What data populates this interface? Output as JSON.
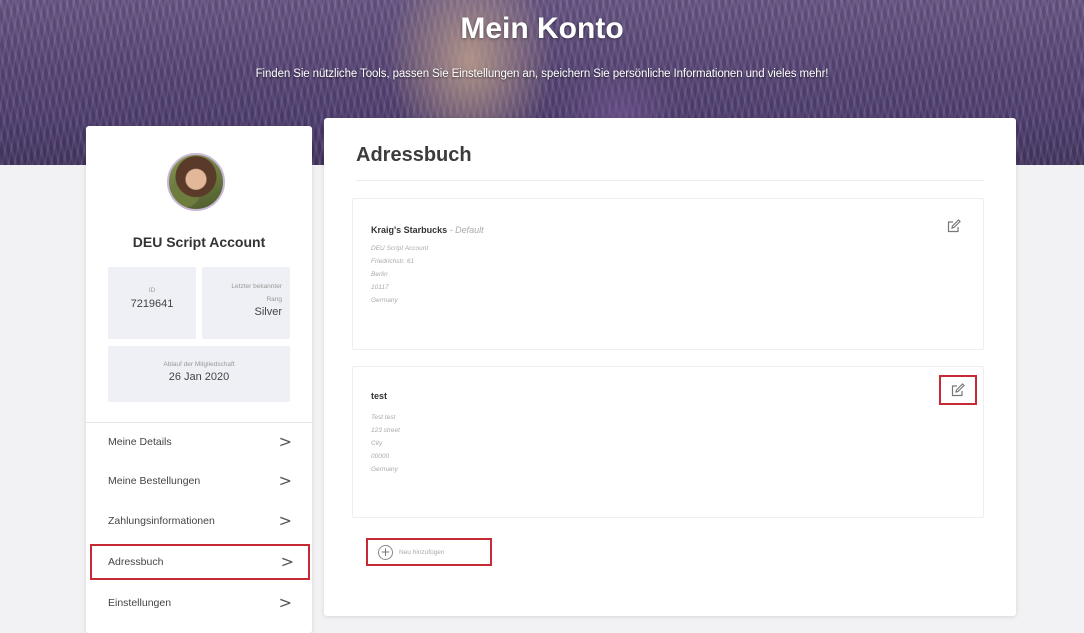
{
  "hero": {
    "title": "Mein Konto",
    "subtitle": "Finden Sie nützliche Tools, passen Sie Einstellungen an, speichern Sie persönliche Informationen und vieles mehr!"
  },
  "profile": {
    "name": "DEU Script Account",
    "id_label": "ID",
    "id_value": "7219641",
    "tier_label_1": "Letzter bekannter",
    "tier_label_2": "Rang",
    "tier_value": "Silver",
    "member_label": "Ablauf der Mitgliedschaft",
    "member_value": "26 Jan 2020"
  },
  "nav": {
    "items": [
      {
        "label": "Meine Details",
        "chevron": ">"
      },
      {
        "label": "Meine Bestellungen",
        "chevron": ">"
      },
      {
        "label": "Zahlungsinformationen",
        "chevron": ">"
      },
      {
        "label": "Adressbuch",
        "chevron": ">"
      },
      {
        "label": "Einstellungen",
        "chevron": ">"
      }
    ],
    "active": "Adressbuch"
  },
  "main": {
    "title": "Adressbuch",
    "addresses": [
      {
        "name": "Kraig's Starbucks",
        "tag": " - Default",
        "lines": [
          "DEU Script Account",
          "Friedrichstr. 61",
          "Berlin",
          "10117",
          "Germany"
        ]
      },
      {
        "name": "test",
        "tag": "",
        "lines": [
          "Test test",
          "123 street",
          "City",
          "00000",
          "Germany"
        ]
      }
    ],
    "add_label": "Neu hinzufügen",
    "add_icon": "plus-circle-icon",
    "edit_icon": "edit-icon"
  },
  "colors": {
    "highlight": "#c62a35",
    "hero": "#5a4a78",
    "background": "#f2f2f4"
  }
}
